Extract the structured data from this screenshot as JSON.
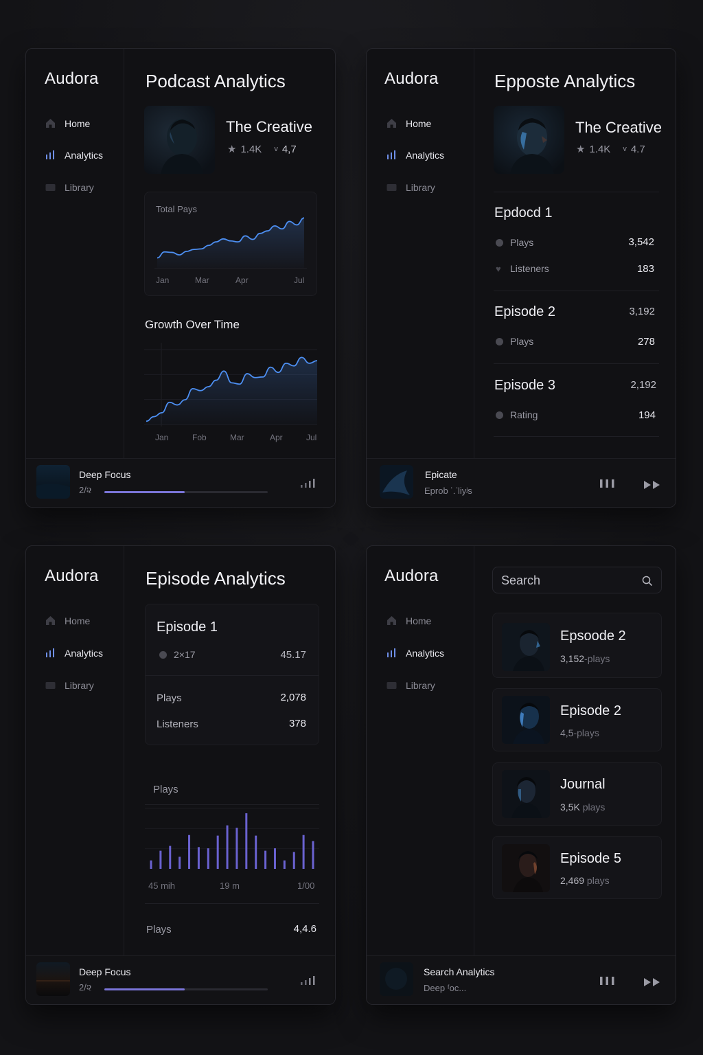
{
  "brand": "Audora",
  "nav": {
    "home": "Home",
    "analytics": "Analytics",
    "library": "Library"
  },
  "colors": {
    "accent": "#7a74d8",
    "line": "#4d8ff2",
    "bar": "#6a62d0",
    "bg": "#111114"
  },
  "panel1": {
    "title": "Podcast Analytics",
    "show": {
      "name": "The Creative",
      "followers": "1.4K",
      "rating": "4,7"
    },
    "total_plays": {
      "label": "Total Pays",
      "ticks": [
        "Jan",
        "Mar",
        "Apr",
        "Jul"
      ]
    },
    "growth": {
      "label": "Growth Over Time",
      "ticks": [
        "Jan",
        "Fob",
        "Mar",
        "Apr",
        "Jul"
      ]
    },
    "player": {
      "title": "Deep Focus",
      "time": "2/૨",
      "progress": 0.49
    }
  },
  "panel2": {
    "title": "Epposte Analytics",
    "show": {
      "name": "The Creative",
      "followers": "1.4K",
      "rating": "4.7"
    },
    "episodes": [
      {
        "title": "Epdocd 1",
        "rows": [
          {
            "label": "Plays",
            "value": "3,542"
          },
          {
            "label": "Listeners",
            "value": "183"
          }
        ]
      },
      {
        "title": "Episode 2",
        "total": "3,192",
        "rows": [
          {
            "label": "Plays",
            "value": "278"
          }
        ]
      },
      {
        "title": "Episode 3",
        "total": "2,192",
        "rows": [
          {
            "label": "Rating",
            "value": "194"
          }
        ]
      }
    ],
    "player": {
      "title": "Epicate",
      "subtitle": "Eprob ⸪liyʲs"
    }
  },
  "panel3": {
    "title": "Episode Analytics",
    "episode": {
      "title": "Episode 1",
      "meta_left": "2×17",
      "meta_right": "45.17"
    },
    "rows": [
      {
        "label": "Plays",
        "value": "2,078"
      },
      {
        "label": "Listeners",
        "value": "378"
      }
    ],
    "plays_label": "Plays",
    "bar_ticks": [
      "45 mih",
      "19 m",
      "1/00"
    ],
    "footer": {
      "label": "Plays",
      "value": "4,4.6"
    },
    "player": {
      "title": "Deep Focus",
      "time": "2/૨",
      "progress": 0.49
    }
  },
  "panel4": {
    "search_placeholder": "Search",
    "episodes": [
      {
        "name": "Epsoode 2",
        "count": "3,152",
        "unit": "-plays"
      },
      {
        "name": "Episode 2",
        "count": "4,5",
        "unit": "-plays"
      },
      {
        "name": "Journal",
        "count": "3,5K",
        "unit": " plays"
      },
      {
        "name": "Episode 5",
        "count": "2,469",
        "unit": " plays"
      }
    ],
    "player": {
      "title": "Search Analytics",
      "subtitle": "Deep ᶠoc..."
    }
  },
  "chart_data": [
    {
      "type": "area",
      "title": "Total Pays",
      "x": [
        0,
        1,
        2,
        3,
        4,
        5,
        6,
        7,
        8,
        9,
        10,
        11,
        12,
        13,
        14,
        15,
        16,
        17,
        18,
        19,
        20
      ],
      "tick_labels": [
        "Jan",
        "Mar",
        "Apr",
        "Jul"
      ],
      "series": [
        {
          "values": [
            20,
            32,
            31,
            26,
            33,
            37,
            38,
            45,
            52,
            58,
            54,
            52,
            64,
            57,
            69,
            74,
            84,
            78,
            93,
            86,
            100
          ]
        }
      ],
      "ylim": [
        0,
        110
      ]
    },
    {
      "type": "area",
      "title": "Growth Over Time",
      "x": [
        0,
        1,
        2,
        3,
        4,
        5,
        6,
        7,
        8,
        9,
        10,
        11,
        12,
        13,
        14,
        15,
        16,
        17,
        18,
        19,
        20,
        21,
        22
      ],
      "tick_labels": [
        "Jan",
        "Fob",
        "Mar",
        "Apr",
        "Jul"
      ],
      "series": [
        {
          "values": [
            5,
            12,
            18,
            34,
            30,
            38,
            55,
            52,
            58,
            68,
            82,
            64,
            62,
            78,
            72,
            73,
            88,
            80,
            94,
            90,
            103,
            94,
            98
          ]
        }
      ],
      "ylim": [
        0,
        115
      ]
    },
    {
      "type": "bar",
      "title": "Plays",
      "tick_labels": [
        "45 mih",
        "19 m",
        "1/00"
      ],
      "values": [
        14,
        30,
        38,
        20,
        56,
        36,
        34,
        55,
        72,
        68,
        92,
        55,
        30,
        34,
        14,
        28,
        56,
        46
      ],
      "ylim": [
        0,
        100
      ]
    }
  ]
}
